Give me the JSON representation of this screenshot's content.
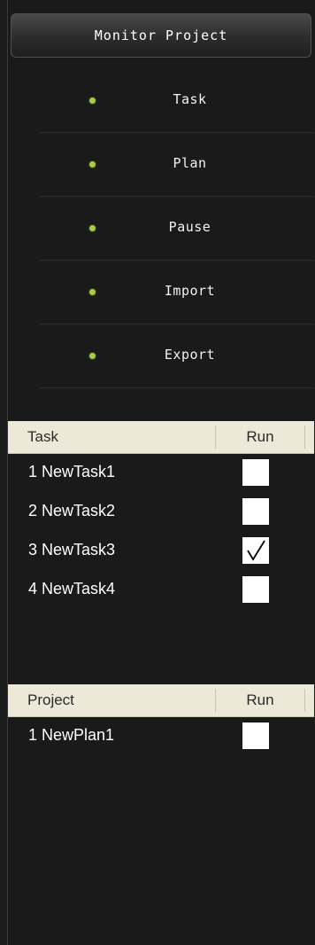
{
  "header": {
    "title": "Monitor Project"
  },
  "menu": {
    "items": [
      {
        "label": "Task"
      },
      {
        "label": "Plan"
      },
      {
        "label": "Pause"
      },
      {
        "label": "Import"
      },
      {
        "label": "Export"
      }
    ]
  },
  "task_table": {
    "columns": [
      "Task",
      "Run"
    ],
    "rows": [
      {
        "name": "1 NewTask1",
        "run": false
      },
      {
        "name": "2 NewTask2",
        "run": false
      },
      {
        "name": "3 NewTask3",
        "run": true
      },
      {
        "name": "4 NewTask4",
        "run": false
      }
    ]
  },
  "project_table": {
    "columns": [
      "Project",
      "Run"
    ],
    "rows": [
      {
        "name": "1 NewPlan1",
        "run": false
      }
    ]
  },
  "colors": {
    "background": "#1a1a1a",
    "dot": "#a7cc3f",
    "table_header": "#ece9d8"
  }
}
